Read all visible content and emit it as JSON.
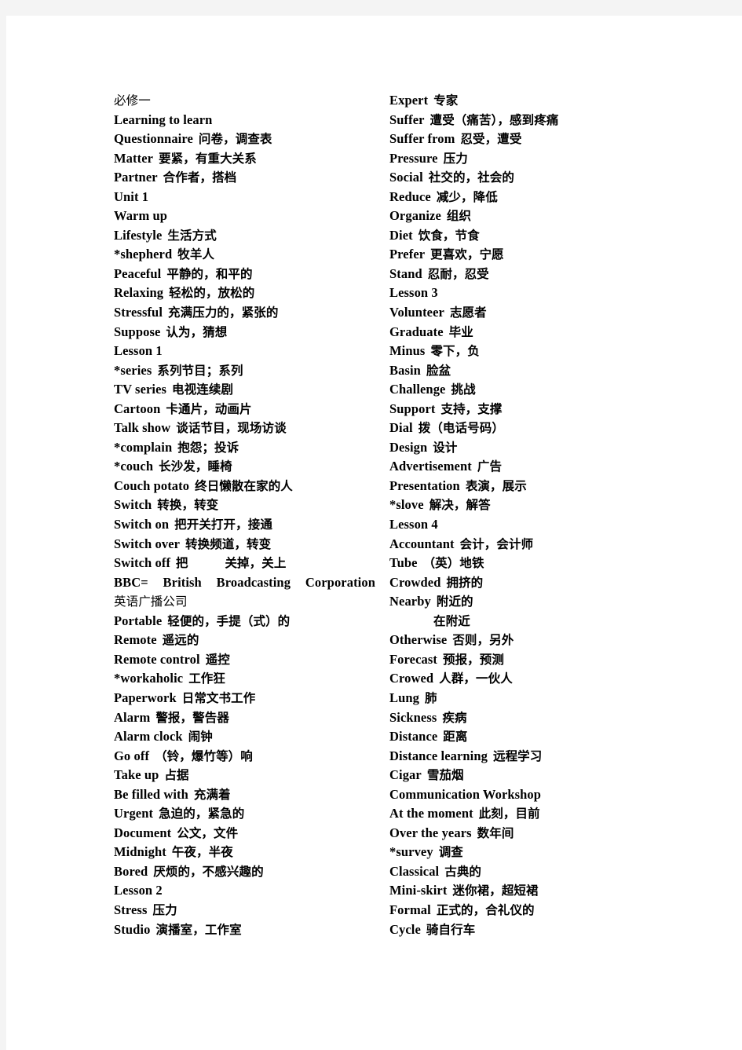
{
  "document": {
    "title": "必修一",
    "page_background": "#ffffff",
    "canvas_background": "#f4f4f4",
    "text_color": "#000000"
  },
  "columns": {
    "left": [
      {
        "en": "",
        "cn": "必修一",
        "style": "plain"
      },
      {
        "en": "Learning to learn",
        "cn": ""
      },
      {
        "en": "Questionnaire",
        "cn": "问卷，调查表"
      },
      {
        "en": "Matter",
        "cn": "要紧，有重大关系"
      },
      {
        "en": "Partner",
        "cn": "合作者，搭档"
      },
      {
        "en": "Unit 1",
        "cn": ""
      },
      {
        "en": "Warm up",
        "cn": ""
      },
      {
        "en": "Lifestyle",
        "cn": "生活方式"
      },
      {
        "en": "*shepherd",
        "cn": "牧羊人"
      },
      {
        "en": "Peaceful",
        "cn": "平静的，和平的"
      },
      {
        "en": "Relaxing",
        "cn": "轻松的，放松的"
      },
      {
        "en": "Stressful",
        "cn": "充满压力的，紧张的"
      },
      {
        "en": "Suppose",
        "cn": "认为，猜想"
      },
      {
        "en": "Lesson 1",
        "cn": ""
      },
      {
        "en": "*series",
        "cn": "系列节目；系列"
      },
      {
        "en": "TV series",
        "cn": "电视连续剧"
      },
      {
        "en": "Cartoon",
        "cn": "卡通片，动画片"
      },
      {
        "en": "Talk show",
        "cn": "谈话节目，现场访谈"
      },
      {
        "en": "*complain",
        "cn": "抱怨；投诉"
      },
      {
        "en": "*couch",
        "cn": "长沙发，睡椅"
      },
      {
        "en": "Couch potato",
        "cn": "终日懒散在家的人"
      },
      {
        "en": "Switch",
        "cn": "转换，转变"
      },
      {
        "en": "Switch on",
        "cn": "把开关打开，接通"
      },
      {
        "en": "Switch over",
        "cn": "转换频道，转变"
      },
      {
        "en": "Switch off",
        "cn": "把　　　关掉，关上",
        "style": "wide-gap"
      },
      {
        "en": "BBC= British Broadcasting Corporation",
        "cn": "",
        "style": "justify",
        "parts": [
          "BBC=",
          "British",
          "Broadcasting",
          "Corporation"
        ]
      },
      {
        "en": "",
        "cn": "英语广播公司",
        "style": "plain"
      },
      {
        "en": "Portable",
        "cn": "轻便的，手提（式）的"
      },
      {
        "en": "Remote",
        "cn": "遥远的"
      },
      {
        "en": "Remote control",
        "cn": "遥控"
      },
      {
        "en": "*workaholic",
        "cn": "工作狂"
      },
      {
        "en": "Paperwork",
        "cn": "日常文书工作"
      },
      {
        "en": "Alarm",
        "cn": "警报，警告器"
      },
      {
        "en": "Alarm clock",
        "cn": "闹钟"
      },
      {
        "en": "Go off",
        "cn": "（铃，爆竹等）响"
      },
      {
        "en": "Take up",
        "cn": "占据"
      },
      {
        "en": "Be filled with",
        "cn": "充满着"
      },
      {
        "en": "Urgent",
        "cn": "急迫的，紧急的"
      },
      {
        "en": "Document",
        "cn": "公文，文件"
      },
      {
        "en": "Midnight",
        "cn": "午夜，半夜"
      },
      {
        "en": "Bored",
        "cn": "厌烦的，不感兴趣的"
      },
      {
        "en": "Lesson 2",
        "cn": ""
      },
      {
        "en": "Stress",
        "cn": "压力"
      },
      {
        "en": "Studio",
        "cn": "演播室，工作室"
      }
    ],
    "right": [
      {
        "en": "Expert",
        "cn": "专家"
      },
      {
        "en": "Suffer",
        "cn": "遭受（痛苦），感到疼痛"
      },
      {
        "en": "Suffer from",
        "cn": "忍受，遭受"
      },
      {
        "en": "Pressure",
        "cn": "压力"
      },
      {
        "en": "Social",
        "cn": "社交的，社会的"
      },
      {
        "en": "Reduce",
        "cn": "减少，降低"
      },
      {
        "en": "Organize",
        "cn": "组织"
      },
      {
        "en": "Diet",
        "cn": "饮食，节食"
      },
      {
        "en": "Prefer",
        "cn": "更喜欢，宁愿"
      },
      {
        "en": "Stand",
        "cn": "忍耐，忍受"
      },
      {
        "en": "Lesson 3",
        "cn": ""
      },
      {
        "en": "Volunteer",
        "cn": "志愿者"
      },
      {
        "en": "Graduate",
        "cn": "毕业"
      },
      {
        "en": "Minus",
        "cn": "零下，负"
      },
      {
        "en": "Basin",
        "cn": "脸盆"
      },
      {
        "en": "Challenge",
        "cn": "挑战"
      },
      {
        "en": "Support",
        "cn": "支持，支撑"
      },
      {
        "en": "Dial",
        "cn": "拨（电话号码）"
      },
      {
        "en": "Design",
        "cn": "设计"
      },
      {
        "en": "Advertisement",
        "cn": "广告"
      },
      {
        "en": "Presentation",
        "cn": "表演，展示"
      },
      {
        "en": "*slove",
        "cn": "解决，解答"
      },
      {
        "en": "Lesson 4",
        "cn": ""
      },
      {
        "en": "Accountant",
        "cn": "会计，会计师"
      },
      {
        "en": "Tube",
        "cn": "（英）地铁"
      },
      {
        "en": "Crowded",
        "cn": "拥挤的"
      },
      {
        "en": "Nearby",
        "cn": "附近的"
      },
      {
        "en": "",
        "cn": "在附近",
        "style": "indent"
      },
      {
        "en": "Otherwise",
        "cn": "否则，另外"
      },
      {
        "en": "Forecast",
        "cn": "预报，预测"
      },
      {
        "en": "Crowed",
        "cn": "人群，一伙人"
      },
      {
        "en": "Lung",
        "cn": "肺"
      },
      {
        "en": "Sickness",
        "cn": "疾病"
      },
      {
        "en": "Distance",
        "cn": "距离"
      },
      {
        "en": "Distance learning",
        "cn": "远程学习"
      },
      {
        "en": "Cigar",
        "cn": "雪茄烟"
      },
      {
        "en": "Communication Workshop",
        "cn": ""
      },
      {
        "en": "At the moment",
        "cn": "此刻，目前"
      },
      {
        "en": "Over the years",
        "cn": "数年间"
      },
      {
        "en": "*survey",
        "cn": "调查"
      },
      {
        "en": "Classical",
        "cn": "古典的"
      },
      {
        "en": "Mini-skirt",
        "cn": "迷你裙，超短裙"
      },
      {
        "en": "Formal",
        "cn": "正式的，合礼仪的"
      },
      {
        "en": "Cycle",
        "cn": "骑自行车"
      }
    ]
  }
}
